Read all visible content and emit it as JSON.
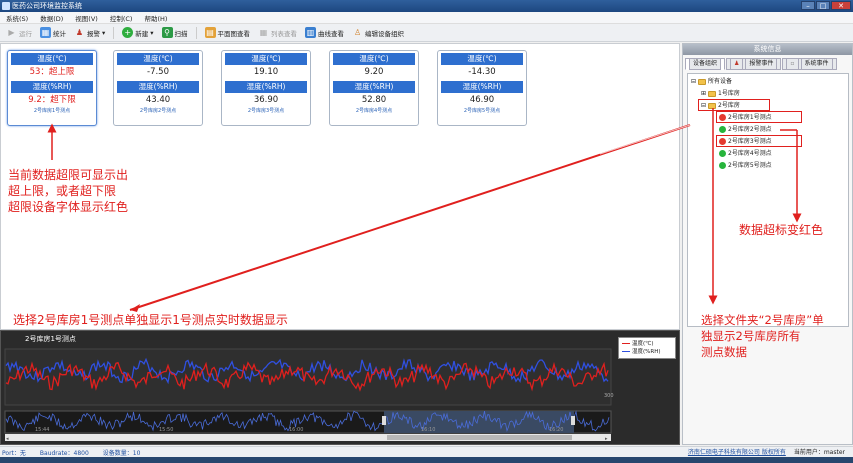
{
  "window": {
    "title": "医药公司环境监控系统"
  },
  "menu": [
    "系统(S)",
    "数据(D)",
    "视图(V)",
    "控制(C)",
    "帮助(H)"
  ],
  "toolbar": {
    "run": "运行",
    "stats": "统计",
    "alarm": "报警",
    "new": "新建",
    "scan": "扫描",
    "plan_view": "平面图查看",
    "list_view": "列表查看",
    "curve_view": "曲线查看",
    "edit_org": "编辑设备组织"
  },
  "cards": [
    {
      "temp_header": "温度(℃)",
      "temp": "53：超上限",
      "hum_header": "湿度(%RH)",
      "hum": "9.2：超下限",
      "label": "2号库房1号测点"
    },
    {
      "temp_header": "温度(℃)",
      "temp": "-7.50",
      "hum_header": "湿度(%RH)",
      "hum": "43.40",
      "label": "2号库房2号测点"
    },
    {
      "temp_header": "温度(℃)",
      "temp": "19.10",
      "hum_header": "湿度(%RH)",
      "hum": "36.90",
      "label": "2号库房3号测点"
    },
    {
      "temp_header": "温度(℃)",
      "temp": "9.20",
      "hum_header": "湿度(%RH)",
      "hum": "52.80",
      "label": "2号库房4号测点"
    },
    {
      "temp_header": "温度(℃)",
      "temp": "-14.30",
      "hum_header": "湿度(%RH)",
      "hum": "46.90",
      "label": "2号库房5号测点"
    }
  ],
  "annotations": {
    "a1": [
      "当前数据超限可显示出",
      "超上限，或者超下限",
      "超限设备字体显示红色"
    ],
    "a2": "选择2号库房1号测点单独显示1号测点实时数据显示",
    "a3": "数据超标变红色",
    "a4": [
      "选择文件夹“2号库房”单",
      "独显示2号库房所有",
      "测点数据"
    ]
  },
  "sidebar": {
    "header": "系统信息",
    "tabs": [
      "设备组织",
      "报警事件",
      "系统事件"
    ],
    "tree": {
      "root": "所有设备",
      "room1": "1号库房",
      "room2": "2号库房",
      "points": [
        {
          "name": "2号库房1号测点",
          "status": "red"
        },
        {
          "name": "2号库房2号测点",
          "status": "green"
        },
        {
          "name": "2号库房3号测点",
          "status": "red"
        },
        {
          "name": "2号库房4号测点",
          "status": "green"
        },
        {
          "name": "2号库房5号测点",
          "status": "green"
        }
      ]
    }
  },
  "chart": {
    "title": "2号库房1号测点",
    "legend": [
      {
        "name": "温度(℃)",
        "color": "#e0201e"
      },
      {
        "name": "湿度(%RH)",
        "color": "#3050e0"
      }
    ],
    "times": [
      "15:44",
      "15:50",
      "16:00",
      "16:10",
      "16:20"
    ]
  },
  "status": {
    "port": "Port：无",
    "baud": "Baudrate：4800",
    "count": "设备数量：10",
    "company": "济南仁硕电子科技有限公司 版权所有",
    "user": "当前用户：master"
  },
  "colors": {
    "accent": "#2e6fcf",
    "alarm": "#e0201e",
    "ok": "#27b43c"
  }
}
